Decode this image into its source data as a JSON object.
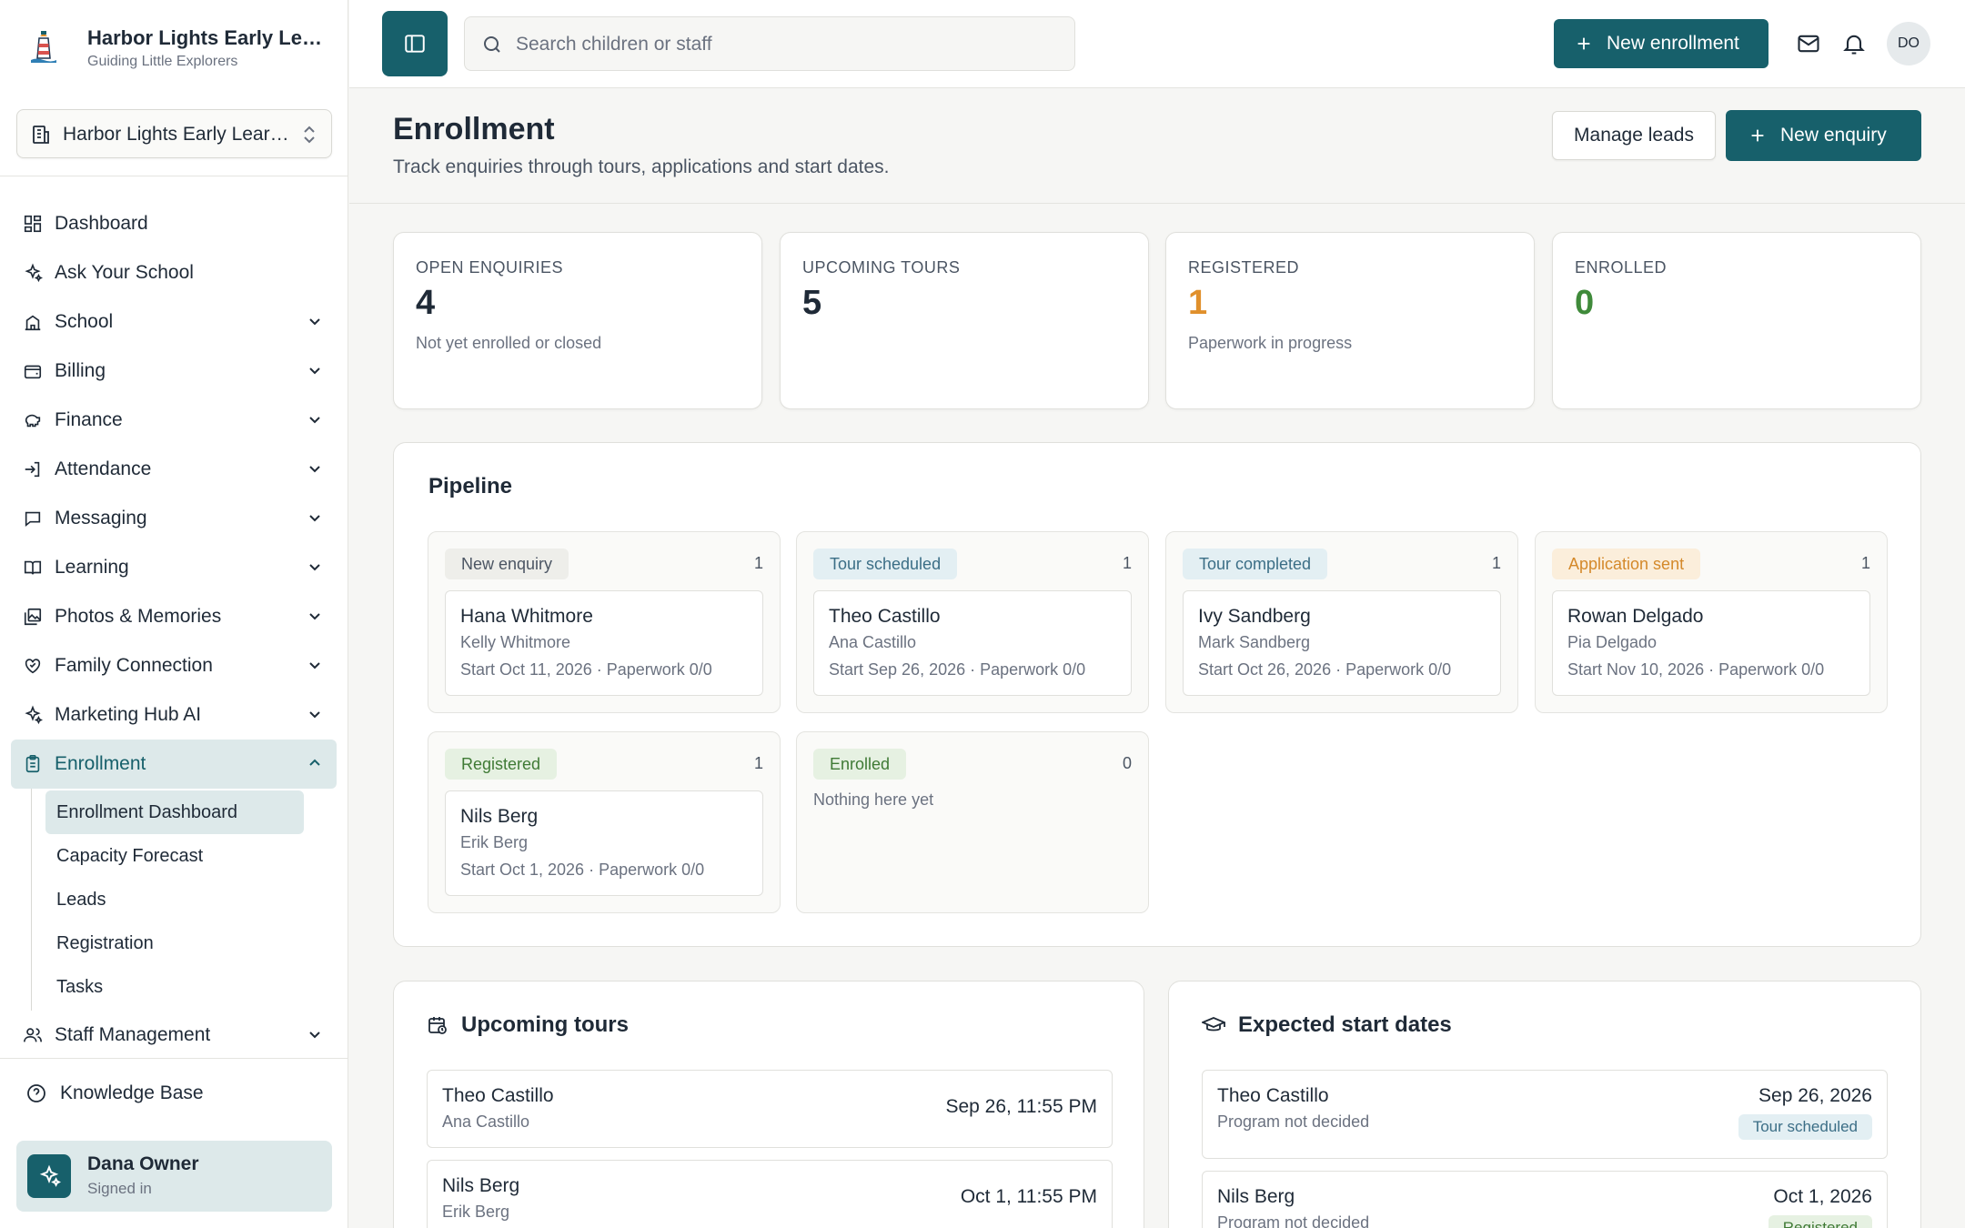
{
  "brand": {
    "title": "Harbor Lights Early Learning",
    "subtitle": "Guiding Little Explorers",
    "school_select": "Harbor Lights Early Learning"
  },
  "sidebar": {
    "items": [
      {
        "label": "Dashboard",
        "icon": "dashboard-icon"
      },
      {
        "label": "Ask Your School",
        "icon": "sparkles-icon"
      },
      {
        "label": "School",
        "icon": "school-icon"
      },
      {
        "label": "Billing",
        "icon": "wallet-icon"
      },
      {
        "label": "Finance",
        "icon": "piggy-bank-icon"
      },
      {
        "label": "Attendance",
        "icon": "log-in-icon"
      },
      {
        "label": "Messaging",
        "icon": "message-icon"
      },
      {
        "label": "Learning",
        "icon": "book-icon"
      },
      {
        "label": "Photos & Memories",
        "icon": "images-icon"
      },
      {
        "label": "Family Connection",
        "icon": "handshake-icon"
      },
      {
        "label": "Marketing Hub AI",
        "icon": "sparkles-icon"
      },
      {
        "label": "Enrollment",
        "icon": "clipboard-icon"
      },
      {
        "label": "Staff Management",
        "icon": "users-icon"
      }
    ],
    "enrollment_sub": [
      "Enrollment Dashboard",
      "Capacity Forecast",
      "Leads",
      "Registration",
      "Tasks"
    ],
    "knowledge_base": "Knowledge Base",
    "user": {
      "name": "Dana Owner",
      "status": "Signed in"
    }
  },
  "topbar": {
    "search_placeholder": "Search children or staff",
    "new_enrollment": "New enrollment",
    "avatar_initials": "DO"
  },
  "header": {
    "title": "Enrollment",
    "subtitle": "Track enquiries through tours, applications and start dates.",
    "manage_leads": "Manage leads",
    "new_enquiry": "New enquiry"
  },
  "stats": [
    {
      "label": "OPEN ENQUIRIES",
      "value": "4",
      "note": "Not yet enrolled or closed",
      "color": "#1f2a37"
    },
    {
      "label": "UPCOMING TOURS",
      "value": "5",
      "note": "",
      "color": "#1f2a37"
    },
    {
      "label": "REGISTERED",
      "value": "1",
      "note": "Paperwork in progress",
      "color": "#e0902c"
    },
    {
      "label": "ENROLLED",
      "value": "0",
      "note": "",
      "color": "#3f8a3a"
    }
  ],
  "pipeline": {
    "title": "Pipeline",
    "columns": [
      {
        "stage": "New enquiry",
        "count": "1",
        "pill_bg": "#eeeeea",
        "pill_fg": "#4b5563",
        "card": {
          "name": "Hana Whitmore",
          "guardian": "Kelly Whitmore",
          "detail": "Start Oct 11, 2026 · Paperwork 0/0"
        }
      },
      {
        "stage": "Tour scheduled",
        "count": "1",
        "pill_bg": "#e3eff3",
        "pill_fg": "#3b6e86",
        "card": {
          "name": "Theo Castillo",
          "guardian": "Ana Castillo",
          "detail": "Start Sep 26, 2026 · Paperwork 0/0"
        }
      },
      {
        "stage": "Tour completed",
        "count": "1",
        "pill_bg": "#e3eff3",
        "pill_fg": "#3b6e86",
        "card": {
          "name": "Ivy Sandberg",
          "guardian": "Mark Sandberg",
          "detail": "Start Oct 26, 2026 · Paperwork 0/0"
        }
      },
      {
        "stage": "Application sent",
        "count": "1",
        "pill_bg": "#fbeedb",
        "pill_fg": "#d4892a",
        "card": {
          "name": "Rowan Delgado",
          "guardian": "Pia Delgado",
          "detail": "Start Nov 10, 2026 · Paperwork 0/0"
        }
      },
      {
        "stage": "Registered",
        "count": "1",
        "pill_bg": "#e6f1e2",
        "pill_fg": "#3f7a35",
        "card": {
          "name": "Nils Berg",
          "guardian": "Erik Berg",
          "detail": "Start Oct 1, 2026 · Paperwork 0/0"
        }
      },
      {
        "stage": "Enrolled",
        "count": "0",
        "pill_bg": "#e6f1e2",
        "pill_fg": "#3f7a35",
        "empty": "Nothing here yet"
      }
    ]
  },
  "upcoming_tours": {
    "title": "Upcoming tours",
    "rows": [
      {
        "name": "Theo Castillo",
        "guardian": "Ana Castillo",
        "when": "Sep 26, 11:55 PM"
      },
      {
        "name": "Nils Berg",
        "guardian": "Erik Berg",
        "when": "Oct 1, 11:55 PM"
      }
    ]
  },
  "expected_starts": {
    "title": "Expected start dates",
    "rows": [
      {
        "name": "Theo Castillo",
        "program": "Program not decided",
        "date": "Sep 26, 2026",
        "status": "Tour scheduled"
      },
      {
        "name": "Nils Berg",
        "program": "Program not decided",
        "date": "Oct 1, 2026",
        "status": "Registered"
      }
    ]
  },
  "colors": {
    "accent": "#17606b",
    "accent_light": "#dde9ea"
  }
}
